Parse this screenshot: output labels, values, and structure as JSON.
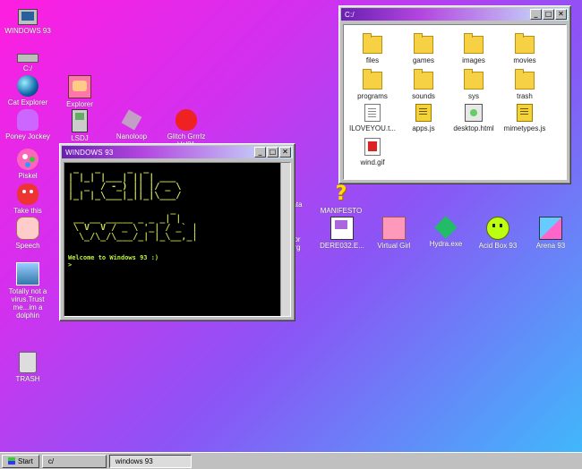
{
  "desktop": {
    "icons": [
      {
        "name": "monitor-icon",
        "label": "WINDOWS 93"
      },
      {
        "name": "drive-icon",
        "label": "C:/"
      },
      {
        "name": "globe-icon",
        "label": "Cat Explorer"
      },
      {
        "name": "explorer-icon",
        "label": "Explorer"
      },
      {
        "name": "pony-icon",
        "label": "Poney Jockey"
      },
      {
        "name": "lsdj-icon",
        "label": "LSDJ"
      },
      {
        "name": "nanoloop-icon",
        "label": "Nanoloop"
      },
      {
        "name": "lips-icon",
        "label": "Glitch Grrrlz Vol01"
      },
      {
        "name": "palette-icon",
        "label": "Piskel"
      },
      {
        "name": "take-this-icon",
        "label": "Take this"
      },
      {
        "name": "speech-icon",
        "label": "Speech"
      },
      {
        "name": "dolphin-icon",
        "label": "Totally not a virus.Trust me...im a dolphin"
      },
      {
        "name": "trash-icon",
        "label": "TRASH"
      },
      {
        "name": "data-icon",
        "label": "ata"
      },
      {
        "name": "question-icon",
        "label": "MANIFESTO"
      },
      {
        "name": "org-icon",
        "label": "or\nrg"
      },
      {
        "name": "floppy-icon",
        "label": "DERE032.E..."
      },
      {
        "name": "face-icon",
        "label": "Virtual Girl"
      },
      {
        "name": "hydra-icon",
        "label": "Hydra.exe"
      },
      {
        "name": "acid-icon",
        "label": "Acid Box 93"
      },
      {
        "name": "cube-icon",
        "label": "Arena 93"
      }
    ]
  },
  "explorer_window": {
    "title": "C:/",
    "buttons": {
      "minimize": "_",
      "maximize": "□",
      "close": "✕"
    },
    "items": [
      {
        "type": "folder",
        "label": "files"
      },
      {
        "type": "folder",
        "label": "games"
      },
      {
        "type": "folder",
        "label": "images"
      },
      {
        "type": "folder",
        "label": "movies"
      },
      {
        "type": "folder",
        "label": "programs"
      },
      {
        "type": "folder",
        "label": "sounds"
      },
      {
        "type": "folder",
        "label": "sys"
      },
      {
        "type": "folder",
        "label": "trash"
      },
      {
        "type": "doc",
        "label": "ILOVEYOU.t..."
      },
      {
        "type": "js",
        "label": "apps.js"
      },
      {
        "type": "html",
        "label": "desktop.html"
      },
      {
        "type": "js",
        "label": "mimetypes.js"
      },
      {
        "type": "gif",
        "label": "wind.gif"
      }
    ]
  },
  "terminal_window": {
    "title": "WINDOWS 93",
    "buttons": {
      "minimize": "_",
      "maximize": "□",
      "close": "✕"
    },
    "ascii_line1": " _   _     _  _      \n| |_| |___| || | ___ \n|  _  / -_) || |/ _ \\\n|_| |_\\___|_||_|\\___/",
    "ascii_line2": "                   _ \n __ __ _____ _ _ _| |\n \\ V  V / _ \\ '_| / _` |\n  \\_/\\_/\\___/_| |_\\__,_|",
    "welcome": "Welcome to Windows 93 :)",
    "prompt": ">"
  },
  "taskbar": {
    "start": "Start",
    "items": [
      "c/",
      "windows 93"
    ],
    "active_index": 1
  }
}
